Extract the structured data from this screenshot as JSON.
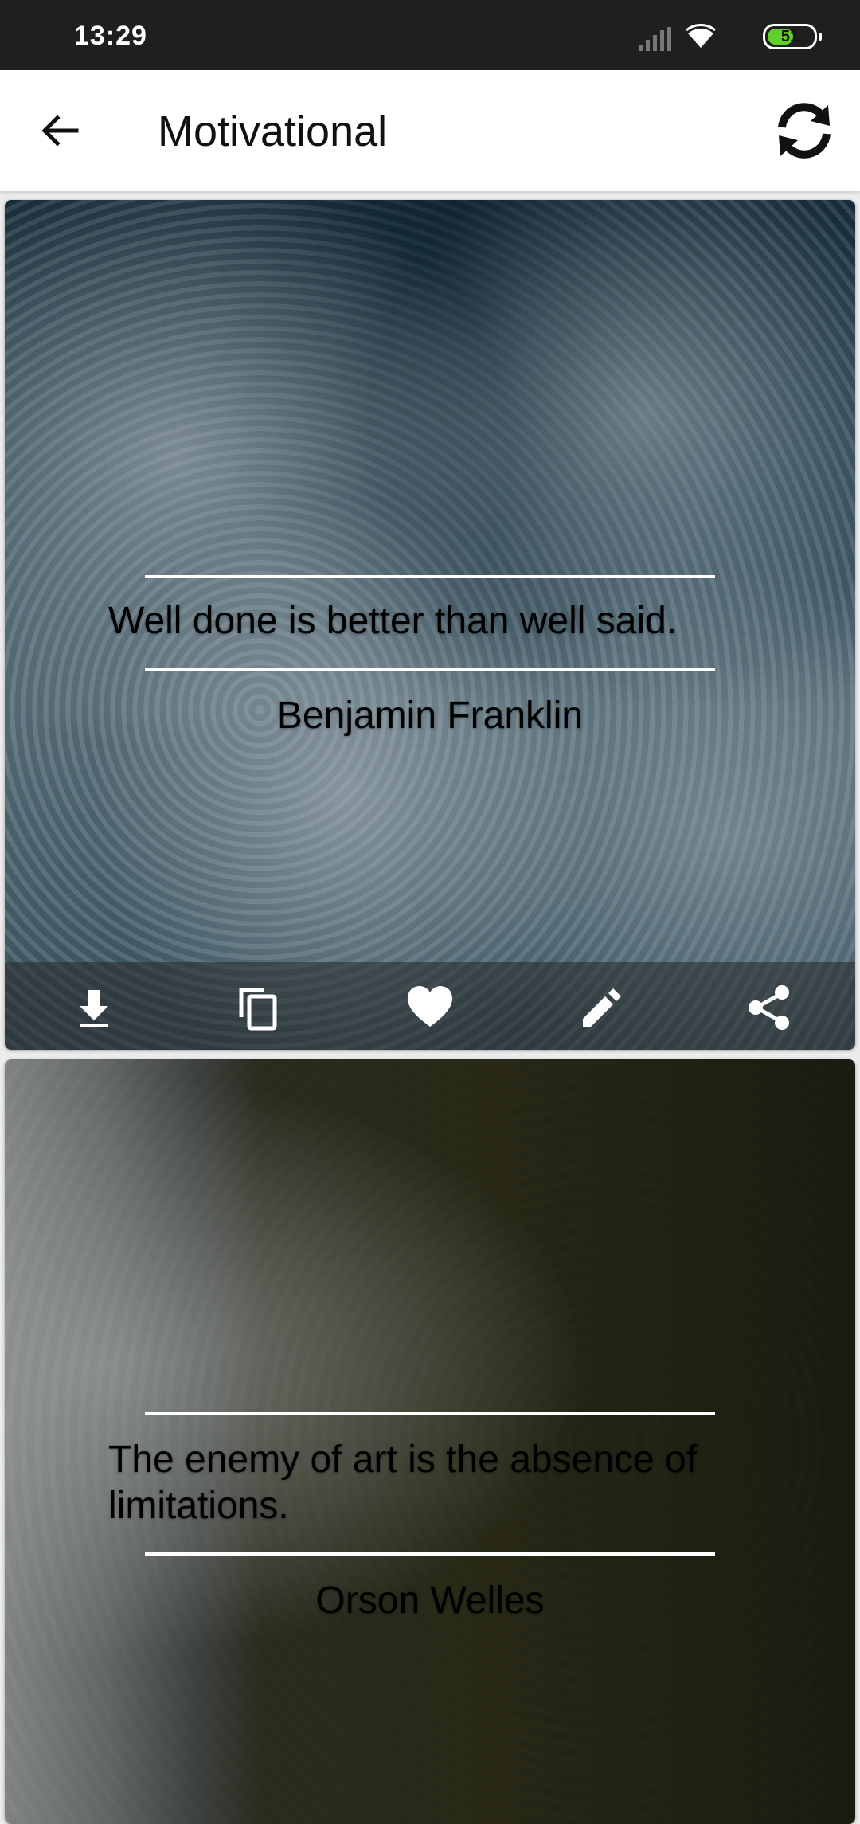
{
  "status_bar": {
    "time": "13:29",
    "battery_level": "51",
    "battery_fill_fraction": 0.51,
    "icons": [
      "signal-icon",
      "wifi-icon",
      "battery-icon"
    ]
  },
  "app_bar": {
    "title": "Motivational",
    "icons": [
      "back-arrow-icon",
      "refresh-icon"
    ]
  },
  "cards": [
    {
      "quote": "Well done is better than well said.",
      "author": "Benjamin Franklin",
      "actions": [
        "download-icon",
        "copy-icon",
        "heart-icon",
        "edit-icon",
        "share-icon"
      ]
    },
    {
      "quote": "The enemy of art is the absence of limitations.",
      "author": "Orson Welles"
    }
  ],
  "colors": {
    "status_bar_bg": "#1f1f1f",
    "app_bar_bg": "#ffffff",
    "battery_fill": "#5fd12a",
    "text_on_image": "#ffffff"
  }
}
